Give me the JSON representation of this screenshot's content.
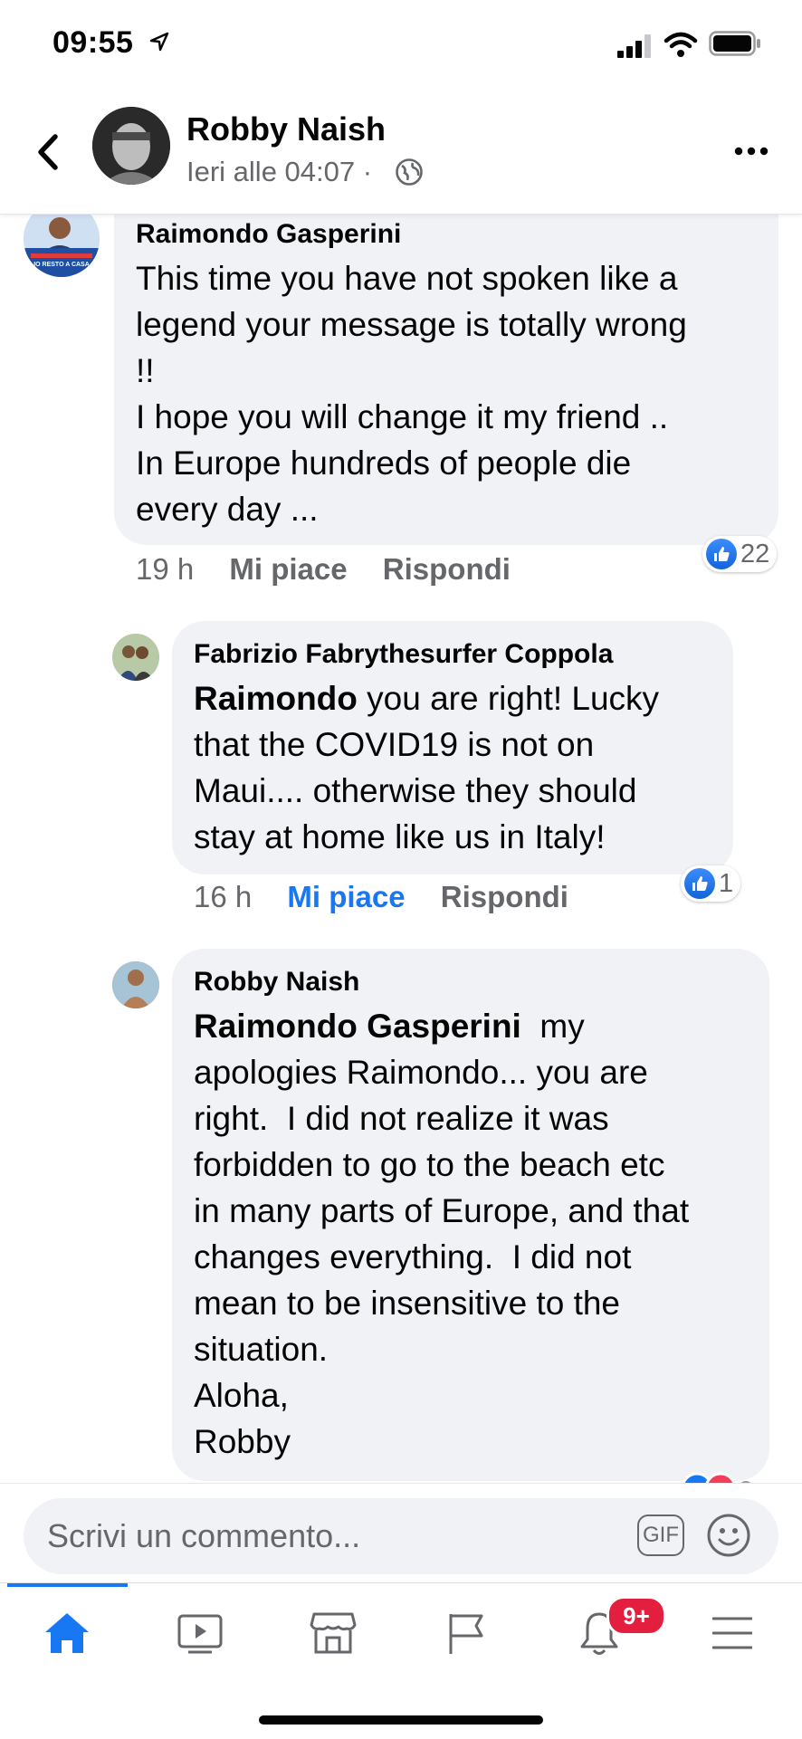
{
  "status_bar": {
    "time": "09:55"
  },
  "header": {
    "page_name": "Robby Naish",
    "meta": "Ieri alle 04:07 ·"
  },
  "comments": [
    {
      "author": "Raimondo Gasperini",
      "lines": [
        "This time you have not spoken like a",
        "legend your message is totally wrong",
        "!!",
        "I hope you will change it my friend ..",
        "In Europe hundreds of people die",
        "every day ..."
      ],
      "time": "19 h",
      "like_label": "Mi piace",
      "reply_label": "Rispondi",
      "reactions": "22",
      "liked": false
    },
    {
      "author": "Fabrizio Fabrythesurfer Coppola",
      "mention": "Raimondo",
      "lines": [
        " you are right! Lucky",
        "that the COVID19 is not on",
        "Maui.... otherwise they should",
        "stay at home like us in Italy!"
      ],
      "time": "16 h",
      "like_label": "Mi piace",
      "reply_label": "Rispondi",
      "reactions": "1",
      "liked": true
    },
    {
      "author": "Robby Naish",
      "mention": "Raimondo Gasperini",
      "lines": [
        "  my",
        "apologies Raimondo... you are",
        "right.  I did not realize it was",
        "forbidden to go to the beach etc",
        "in many parts of Europe, and that",
        "changes everything.  I did not",
        "mean to be insensitive to the",
        "situation.",
        "Aloha,",
        "Robby"
      ]
    }
  ],
  "composer": {
    "placeholder": "Scrivi un commento...",
    "gif_label": "GIF"
  },
  "tabbar": {
    "items": [
      {
        "name": "home",
        "icon": "home-icon",
        "active": true
      },
      {
        "name": "watch",
        "icon": "video-icon",
        "active": false
      },
      {
        "name": "marketplace",
        "icon": "marketplace-icon",
        "active": false
      },
      {
        "name": "pages",
        "icon": "flag-icon",
        "active": false
      },
      {
        "name": "notifications",
        "icon": "bell-icon",
        "active": false
      },
      {
        "name": "menu",
        "icon": "menu-icon",
        "active": false
      }
    ],
    "notification_badge": "9+"
  },
  "colors": {
    "accent": "#1877f2",
    "bubble": "#f0f2f5",
    "secondary_text": "#65676b",
    "badge": "#e41e3f"
  }
}
